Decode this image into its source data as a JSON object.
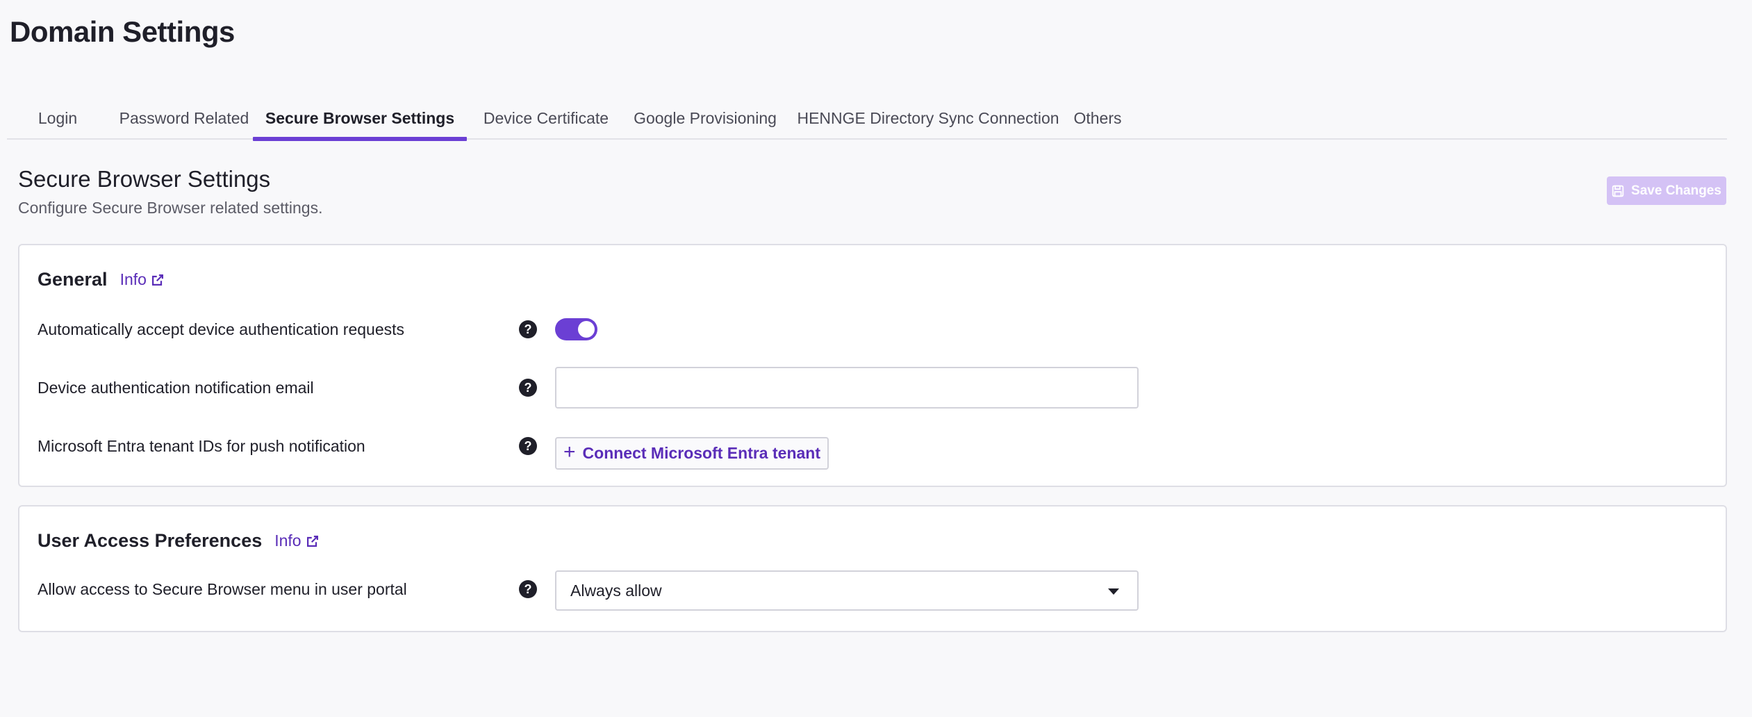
{
  "page": {
    "title": "Domain Settings"
  },
  "tabs": [
    {
      "label": "Login",
      "active": false
    },
    {
      "label": "Password Related",
      "active": false
    },
    {
      "label": "Secure Browser Settings",
      "active": true
    },
    {
      "label": "Device Certificate",
      "active": false
    },
    {
      "label": "Google Provisioning",
      "active": false
    },
    {
      "label": "HENNGE Directory Sync Connection",
      "active": false
    },
    {
      "label": "Others",
      "active": false
    }
  ],
  "section": {
    "title": "Secure Browser Settings",
    "subtitle": "Configure Secure Browser related settings.",
    "save_label": "Save Changes",
    "save_icon": "floppy-disk-icon",
    "save_enabled": false
  },
  "general": {
    "heading": "General",
    "info_label": "Info",
    "info_icon": "external-link-icon",
    "rows": {
      "auto_accept": {
        "label": "Automatically accept device authentication requests",
        "enabled": true
      },
      "notify_email": {
        "label": "Device authentication notification email",
        "value": "",
        "placeholder": ""
      },
      "entra": {
        "label": "Microsoft Entra tenant IDs for push notification",
        "button_label": "Connect Microsoft Entra tenant",
        "button_icon": "plus-icon"
      }
    },
    "help_symbol": "?"
  },
  "access": {
    "heading": "User Access Preferences",
    "info_label": "Info",
    "rows": {
      "portal_menu": {
        "label": "Allow access to Secure Browser menu in user portal",
        "selected": "Always allow"
      }
    }
  },
  "colors": {
    "accent": "#6b3fd4",
    "link": "#5a2db8",
    "save_disabled": "#d4c2f5",
    "background": "#f8f8fa"
  }
}
